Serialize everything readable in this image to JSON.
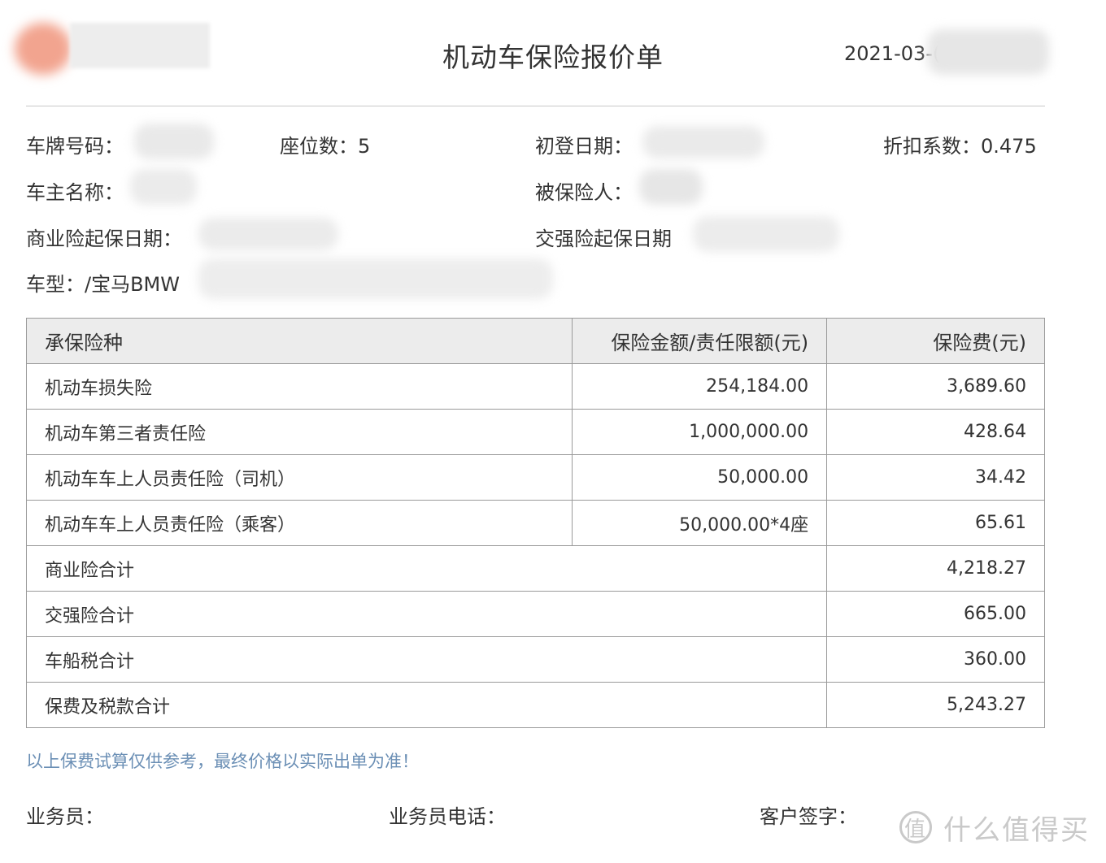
{
  "header": {
    "title": "机动车保险报价单",
    "date": "2021-03-("
  },
  "info": {
    "plate_label": "车牌号码：",
    "seats_label": "座位数：",
    "seats_value": "5",
    "first_reg_label": "初登日期：",
    "discount_label": "折扣系数：",
    "discount_value": "0.475",
    "owner_label": "车主名称：",
    "insured_label": "被保险人：",
    "commercial_start_label": "商业险起保日期：",
    "compulsory_start_label": "交强险起保日期",
    "model_label": "车型：",
    "model_value": "/宝马BMW"
  },
  "table": {
    "headers": [
      "承保险种",
      "保险金额/责任限额(元)",
      "保险费(元)"
    ],
    "rows": [
      {
        "type": "机动车损失险",
        "amount": "254,184.00",
        "premium": "3,689.60"
      },
      {
        "type": "机动车第三者责任险",
        "amount": "1,000,000.00",
        "premium": "428.64"
      },
      {
        "type": "机动车车上人员责任险（司机）",
        "amount": "50,000.00",
        "premium": "34.42"
      },
      {
        "type": "机动车车上人员责任险（乘客）",
        "amount": "50,000.00*4座",
        "premium": "65.61"
      }
    ],
    "totals": [
      {
        "label": "商业险合计",
        "value": "4,218.27"
      },
      {
        "label": "交强险合计",
        "value": "665.00"
      },
      {
        "label": "车船税合计",
        "value": "360.00"
      },
      {
        "label": "保费及税款合计",
        "value": "5,243.27"
      }
    ]
  },
  "note": "以上保费试算仅供参考，最终价格以实际出单为准！",
  "footer": {
    "agent_label": "业务员：",
    "agent_phone_label": "业务员电话：",
    "customer_sign_label": "客户签字："
  },
  "watermark": {
    "icon": "值",
    "text": "什么值得买"
  }
}
